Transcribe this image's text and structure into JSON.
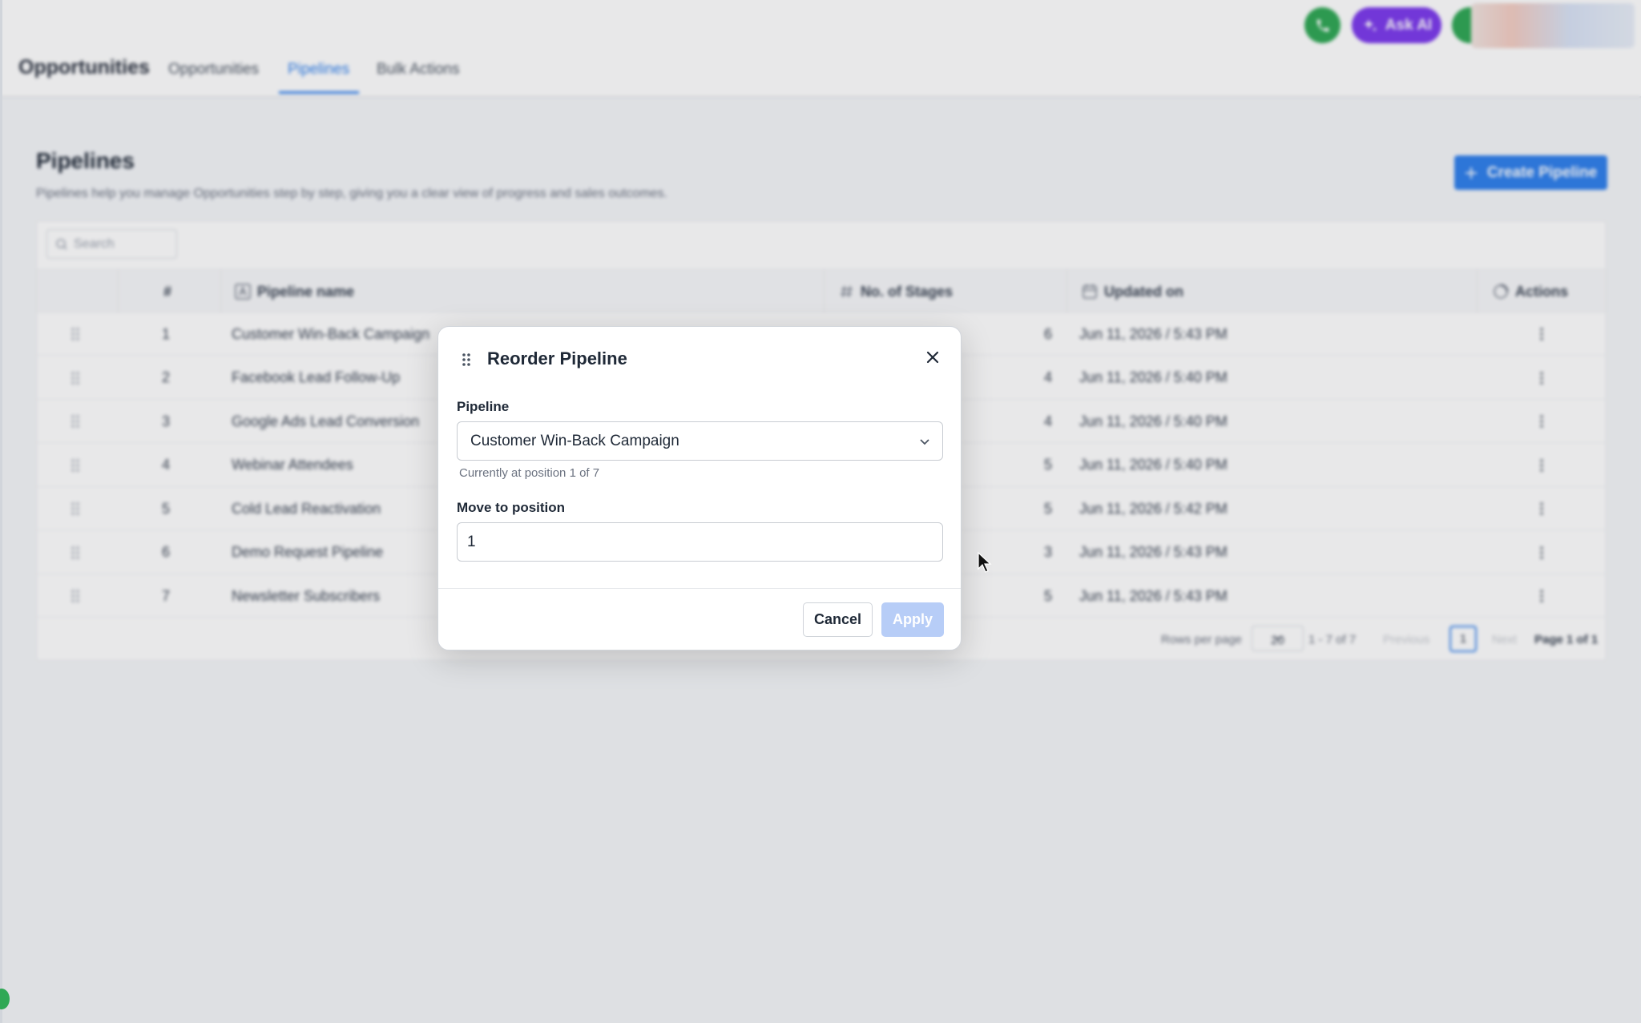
{
  "header": {
    "app_title": "Opportunities",
    "tabs": [
      {
        "label": "Opportunities",
        "active": false
      },
      {
        "label": "Pipelines",
        "active": true
      },
      {
        "label": "Bulk Actions",
        "active": false
      }
    ],
    "ask_ai_label": "Ask AI"
  },
  "page": {
    "title": "Pipelines",
    "subtitle": "Pipelines help you manage Opportunities step by step, giving you a clear view of progress and sales outcomes.",
    "create_button": "Create Pipeline"
  },
  "table": {
    "search_placeholder": "Search",
    "columns": {
      "index": "#",
      "name": "Pipeline name",
      "stages": "No. of Stages",
      "updated": "Updated on",
      "actions": "Actions"
    },
    "rows": [
      {
        "index": "1",
        "name": "Customer Win-Back Campaign",
        "stages": "6",
        "updated": "Jun 11, 2026 / 5:43 PM"
      },
      {
        "index": "2",
        "name": "Facebook Lead Follow-Up",
        "stages": "4",
        "updated": "Jun 11, 2026 / 5:40 PM"
      },
      {
        "index": "3",
        "name": "Google Ads Lead Conversion",
        "stages": "4",
        "updated": "Jun 11, 2026 / 5:40 PM"
      },
      {
        "index": "4",
        "name": "Webinar Attendees",
        "stages": "5",
        "updated": "Jun 11, 2026 / 5:40 PM"
      },
      {
        "index": "5",
        "name": "Cold Lead Reactivation",
        "stages": "5",
        "updated": "Jun 11, 2026 / 5:42 PM"
      },
      {
        "index": "6",
        "name": "Demo Request Pipeline",
        "stages": "3",
        "updated": "Jun 11, 2026 / 5:43 PM"
      },
      {
        "index": "7",
        "name": "Newsletter Subscribers",
        "stages": "5",
        "updated": "Jun 11, 2026 / 5:43 PM"
      }
    ],
    "pagination": {
      "rows_per_page_label": "Rows per page",
      "rows_per_page": "20",
      "range": "1 - 7 of 7",
      "previous": "Previous",
      "current_page": "1",
      "next": "Next",
      "page_of": "Page 1 of 1"
    }
  },
  "modal": {
    "title": "Reorder Pipeline",
    "pipeline_label": "Pipeline",
    "pipeline_value": "Customer Win-Back Campaign",
    "helper": "Currently at position 1 of 7",
    "position_label": "Move to position",
    "position_value": "1",
    "cancel_label": "Cancel",
    "apply_label": "Apply"
  },
  "colors": {
    "accent": "#2f80ed",
    "ask_ai": "#7c3aed",
    "phone": "#2fa855",
    "apply_disabled": "#b7cdf7"
  }
}
